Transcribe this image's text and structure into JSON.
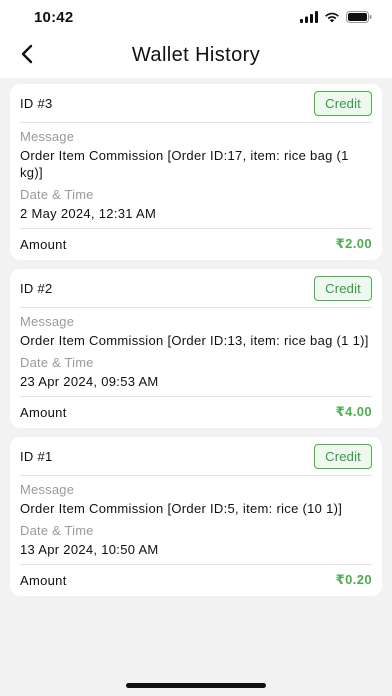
{
  "status_bar": {
    "time": "10:42"
  },
  "header": {
    "title": "Wallet History"
  },
  "colors": {
    "credit": "#4caf50",
    "badge_bg": "#eef8ef"
  },
  "transactions": [
    {
      "id": "ID #3",
      "type": "Credit",
      "message_label": "Message",
      "message": "Order Item Commission [Order ID:17, item: rice bag (1 kg)]",
      "date_label": "Date & Time",
      "date": "2 May 2024, 12:31 AM",
      "amount_label": "Amount",
      "amount": "₹2.00"
    },
    {
      "id": "ID #2",
      "type": "Credit",
      "message_label": "Message",
      "message": "Order Item Commission [Order ID:13, item: rice bag (1 1)]",
      "date_label": "Date & Time",
      "date": "23 Apr 2024, 09:53 AM",
      "amount_label": "Amount",
      "amount": "₹4.00"
    },
    {
      "id": "ID #1",
      "type": "Credit",
      "message_label": "Message",
      "message": "Order Item Commission [Order ID:5, item: rice (10 1)]",
      "date_label": "Date & Time",
      "date": "13 Apr 2024, 10:50 AM",
      "amount_label": "Amount",
      "amount": "₹0.20"
    }
  ]
}
